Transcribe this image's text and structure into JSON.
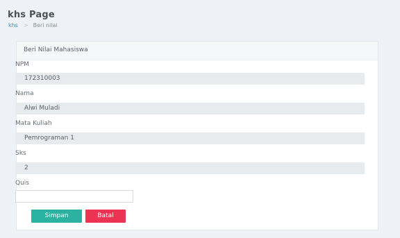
{
  "header": {
    "title": "khs Page",
    "breadcrumb": {
      "home": "khs",
      "separator": ">",
      "current": "Beri nilai"
    }
  },
  "card": {
    "title": "Beri Nilai Mahasiswa"
  },
  "form": {
    "fields": [
      {
        "label": "NPM",
        "value": "172310003"
      },
      {
        "label": "Nama",
        "value": "Alwi Muladi"
      },
      {
        "label": "Mata Kuliah",
        "value": "Pemrograman 1"
      },
      {
        "label": "Sks",
        "value": "2"
      }
    ],
    "quis": {
      "label": "Quis",
      "value": ""
    },
    "buttons": {
      "save": "Simpan",
      "cancel": "Batal"
    }
  },
  "colors": {
    "save_button": "#2bb2a0",
    "cancel_button": "#ed3353",
    "breadcrumb_link": "#3c8dbc",
    "background": "#eef1f5"
  }
}
